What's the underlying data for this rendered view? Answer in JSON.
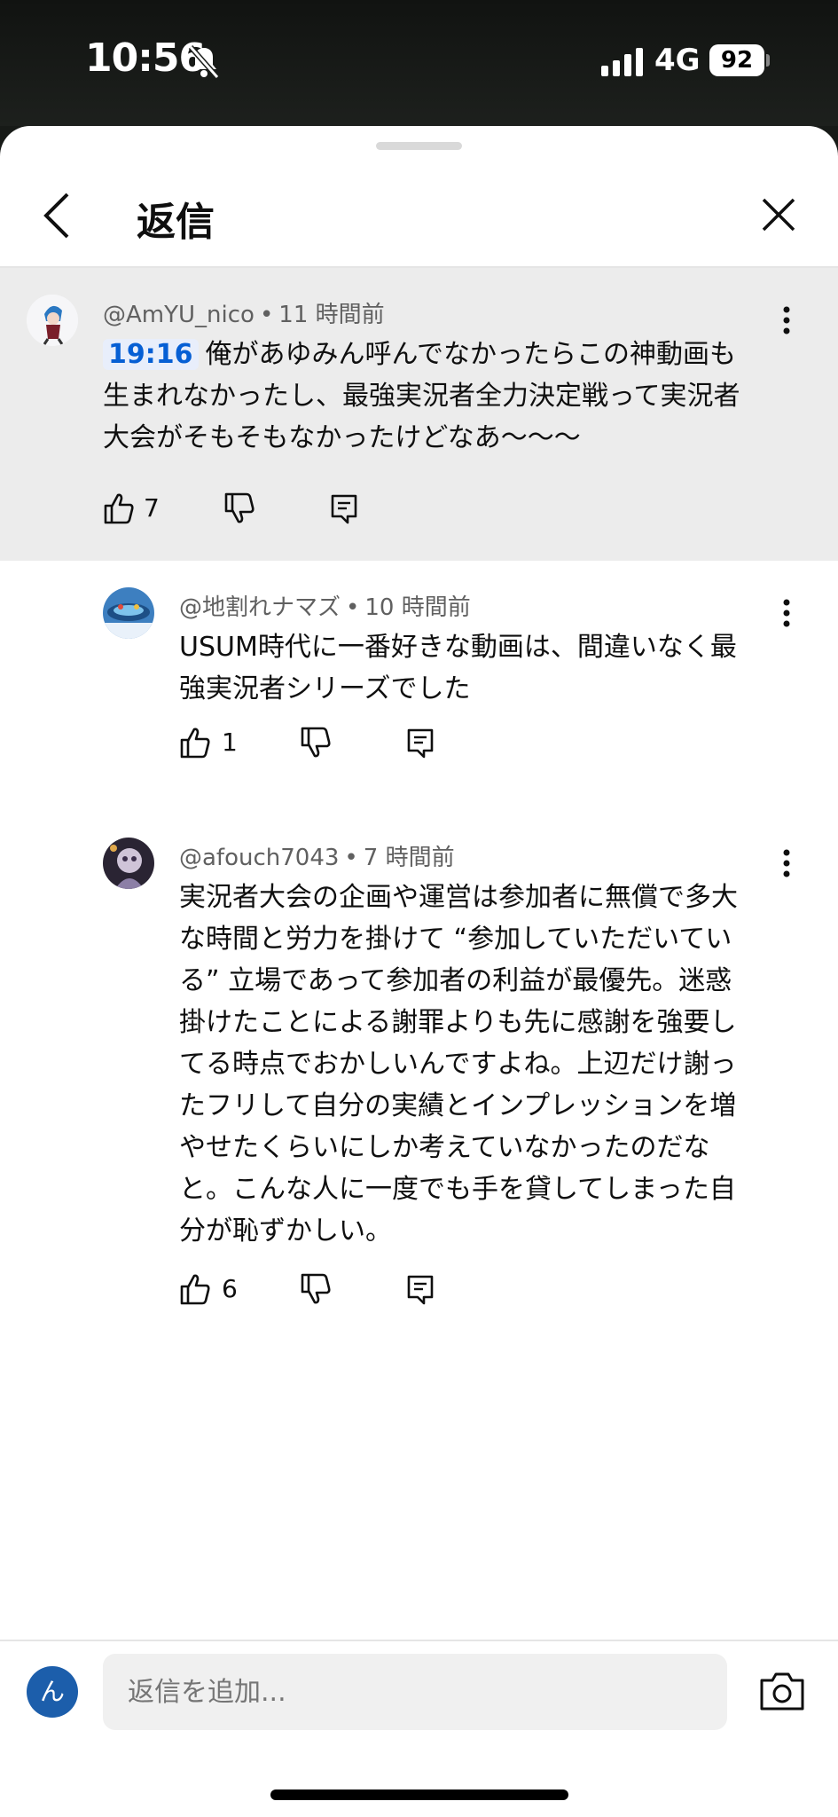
{
  "status_bar": {
    "time": "10:56",
    "network": "4G",
    "battery": "92"
  },
  "header": {
    "title": "返信"
  },
  "parent_comment": {
    "author": "@AmYU_nico",
    "age": "11 時間前",
    "timestamp_link": "19:16",
    "text_lines": [
      "俺があゆみん呼んでなかったらこの神動画も",
      "生まれなかったし、最強実況者全力決定戦って実況者",
      "大会がそもそもなかったけどなあ〜〜〜"
    ],
    "likes": "7"
  },
  "replies": [
    {
      "author": "@地割れナマズ",
      "age": "10 時間前",
      "text_lines": [
        "USUM時代に一番好きな動画は、間違いなく最",
        "強実況者シリーズでした"
      ],
      "likes": "1"
    },
    {
      "author": "@afouch7043",
      "age": "7 時間前",
      "text_lines": [
        "実況者大会の企画や運営は参加者に無償で多大",
        "な時間と労力を掛けて “参加していただいてい",
        "る” 立場であって参加者の利益が最優先。迷惑",
        "掛けたことによる謝罪よりも先に感謝を強要し",
        "てる時点でおかしいんですよね。上辺だけ謝っ",
        "たフリして自分の実績とインプレッションを増",
        "やせたくらいにしか考えていなかったのだな",
        "と。こんな人に一度でも手を貸してしまった自",
        "分が恥ずかしい。"
      ],
      "likes": "6"
    }
  ],
  "reply_bar": {
    "avatar_initial": "ん",
    "placeholder": "返信を追加..."
  },
  "icons": [
    "bell-slash-icon",
    "back-chevron-icon",
    "close-icon",
    "like-icon",
    "dislike-icon",
    "reply-icon",
    "more-vert-icon",
    "camera-icon"
  ]
}
